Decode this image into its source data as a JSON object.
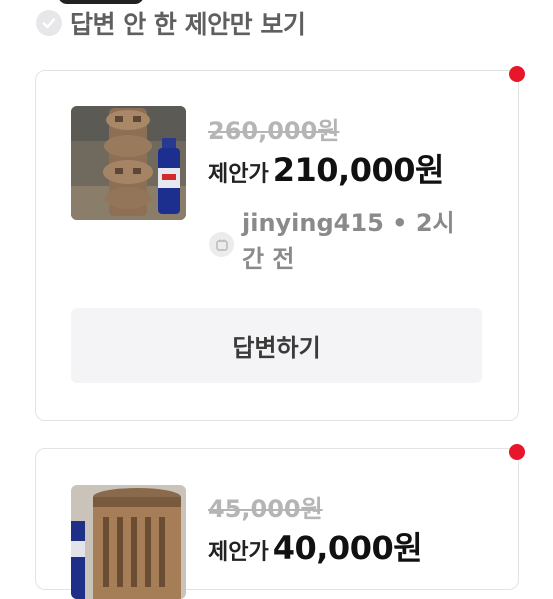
{
  "filter": {
    "label": "답변 안 한 제안만 보기",
    "checked": false,
    "icon": "check-icon"
  },
  "offers": [
    {
      "original_price": "260,000원",
      "offer_label": "제안가",
      "offer_price": "210,000원",
      "user_line": "jinying415 • 2시간 전",
      "reply_label": "답변하기",
      "unread": true
    },
    {
      "original_price": "45,000원",
      "offer_label": "제안가",
      "offer_price": "40,000원",
      "unread": true
    }
  ],
  "colors": {
    "unread_dot": "#e8162b",
    "strike_price": "#b5b5b5",
    "button_bg": "#f4f4f6"
  }
}
